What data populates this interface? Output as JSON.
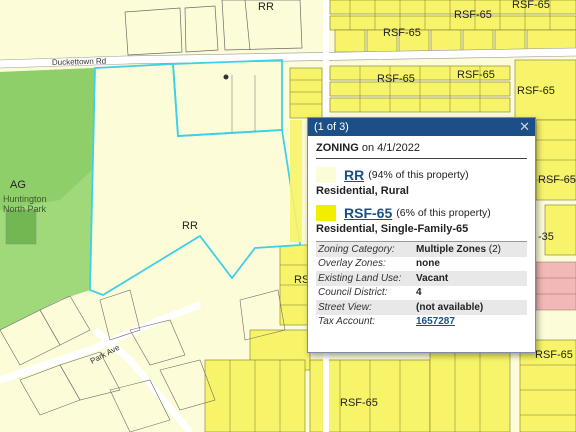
{
  "map": {
    "labels": {
      "rr_top": "RR",
      "rsf_top1": "RSF-65",
      "rsf_top2": "RSF-65",
      "rsf_top3": "RSF-65",
      "rsf_mid1": "RSF-65",
      "rsf_mid2": "RSF-65",
      "rsf_mid3": "RSF-65",
      "rsf_right": "RSF-65",
      "rsf_partial": "RS",
      "rsf_35": "-35",
      "rsf_bottom1": "RSF-65",
      "rsf_bottom2": "RSF-65",
      "rr_center": "RR",
      "ag": "AG",
      "park_line1": "Huntington",
      "park_line2": "North Park",
      "road_duckettown": "Duckettown Rd",
      "road_park": "Park Ave"
    },
    "colors": {
      "rr": "#fdfcd8",
      "rsf65": "#f7f46a",
      "ag": "#9fd97a",
      "park": "#7cc35a",
      "selected_outline": "#3ed0e8",
      "parcel_line": "#6b6b6b",
      "pink_zone": "#f2b8b8"
    }
  },
  "popup": {
    "header": "(1 of 3)",
    "close_icon": "close-icon",
    "zoning_label": "ZONING",
    "zoning_date": "on 4/1/2022",
    "zones": [
      {
        "code": "RR",
        "pct": "(94% of this property)",
        "desc": "Residential, Rural",
        "color": "#fdfcd8"
      },
      {
        "code": "RSF-65",
        "pct": "(6% of this property)",
        "desc": "Residential, Single-Family-65",
        "color": "#f2ee00"
      }
    ],
    "attributes": [
      {
        "key": "Zoning Category:",
        "value": "Multiple Zones",
        "suffix": "(2)"
      },
      {
        "key": "Overlay Zones:",
        "value": "none"
      },
      {
        "key": "Existing Land Use:",
        "value": "Vacant"
      },
      {
        "key": "Council District:",
        "value": "4"
      },
      {
        "key": "Street View:",
        "value": "(not available)"
      },
      {
        "key": "Tax Account:",
        "value": "1657287"
      }
    ]
  }
}
